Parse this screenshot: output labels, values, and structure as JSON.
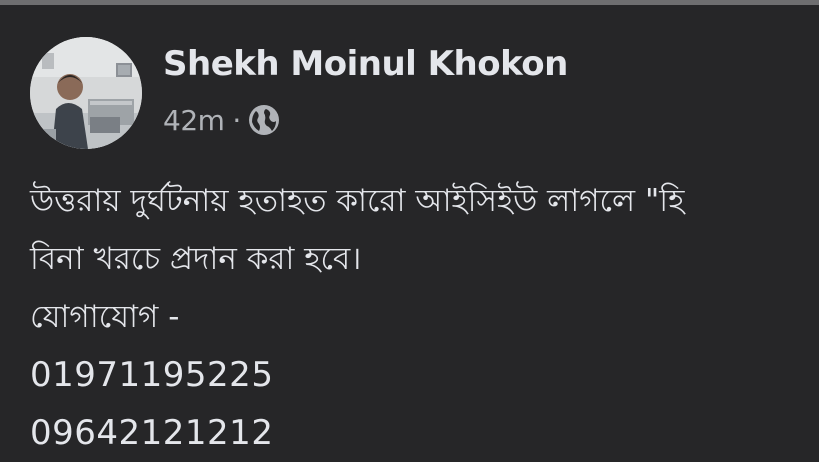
{
  "post": {
    "author": "Shekh Moinul Khokon",
    "timestamp": "42m",
    "separator": "·",
    "audience_icon": "globe-icon",
    "lines": [
      "উত্তরায় দুর্ঘটনায় হতাহত কারো আইসিইউ লাগলে \"হি",
      "বিনা খরচে প্রদান করা হবে।",
      "যোগাযোগ -",
      "01971195225",
      "09642121212"
    ]
  },
  "colors": {
    "background": "#262628",
    "primary_text": "#e4e6eb",
    "secondary_text": "#b0b3b8",
    "top_border": "#6e6e70"
  }
}
